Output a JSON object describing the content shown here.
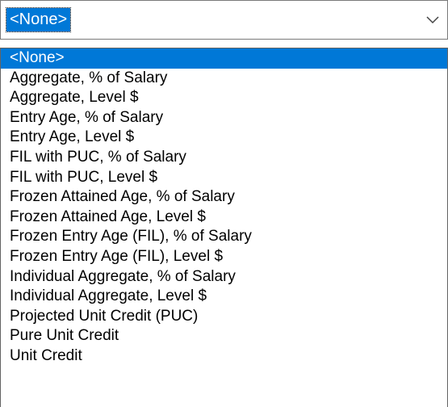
{
  "combo": {
    "selected_value": "<None>",
    "arrow_icon": "chevron-down-icon"
  },
  "colors": {
    "highlight": "#0078d7",
    "highlight_text": "#ffffff",
    "border": "#7a7a7a"
  },
  "options": [
    "<None>",
    "Aggregate, % of Salary",
    "Aggregate, Level $",
    "Entry Age, % of Salary",
    "Entry Age, Level $",
    "FIL with PUC, % of Salary",
    "FIL with PUC, Level $",
    "Frozen Attained Age, % of Salary",
    "Frozen Attained Age, Level $",
    "Frozen Entry Age (FIL), % of Salary",
    "Frozen Entry Age (FIL), Level $",
    "Individual Aggregate, % of Salary",
    "Individual Aggregate, Level $",
    "Projected Unit Credit (PUC)",
    "Pure Unit Credit",
    "Unit Credit"
  ],
  "highlighted_index": 0
}
